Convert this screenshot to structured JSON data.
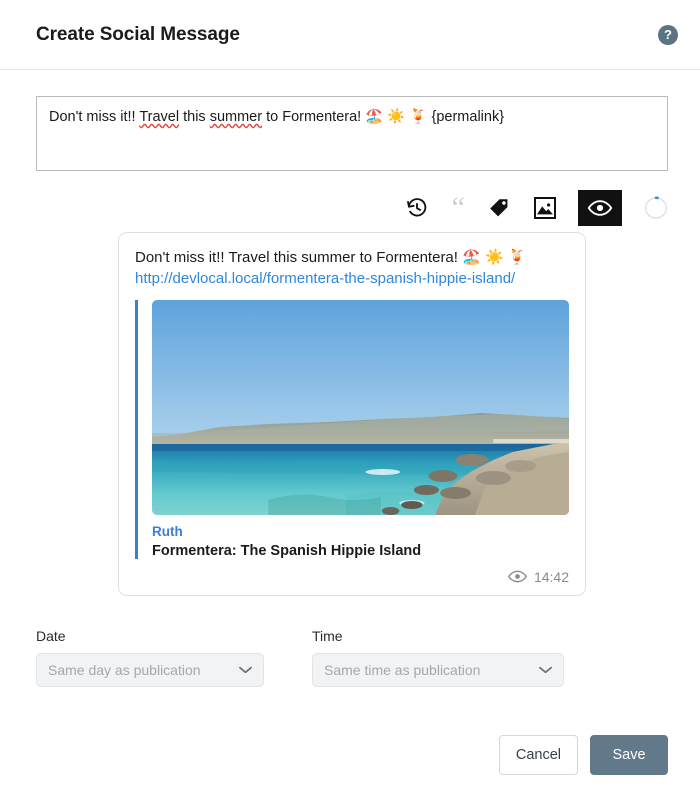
{
  "header": {
    "title": "Create Social Message",
    "help_label": "?"
  },
  "compose": {
    "text_before": "Don't miss it!! ",
    "misspelled_1": "Travel",
    "text_mid_1": " this ",
    "misspelled_2": "summer",
    "text_mid_2": " to Formentera! ",
    "emojis": "🏖️ ☀️ 🍹",
    "placeholder_token": " {permalink}",
    "full_text": "Don't miss it!! Travel this summer to Formentera! 🏖️ ☀️ 🍹 {permalink}"
  },
  "toolbar": {
    "history_label": "History",
    "quote_label": "“",
    "tag_label": "Tag",
    "image_label": "Image",
    "preview_label": "Preview",
    "counter_label": "Character counter"
  },
  "preview": {
    "message": "Don't miss it!! Travel this summer to Formentera! 🏖️ ☀️ 🍹",
    "link": "http://devlocal.local/formentera-the-spanish-hippie-island/",
    "author": "Ruth",
    "title": "Formentera: The Spanish Hippie Island",
    "time": "14:42",
    "image_alt": "Coastal view of Formentera with turquoise sea and rocky shore"
  },
  "schedule": {
    "date_label": "Date",
    "date_value": "Same day as publication",
    "time_label": "Time",
    "time_value": "Same time as publication"
  },
  "footer": {
    "cancel_label": "Cancel",
    "save_label": "Save"
  },
  "colors": {
    "accent_slate": "#62798a",
    "link_blue": "#2e86de",
    "embed_blue": "#3c7fd0",
    "active_black": "#111111"
  }
}
